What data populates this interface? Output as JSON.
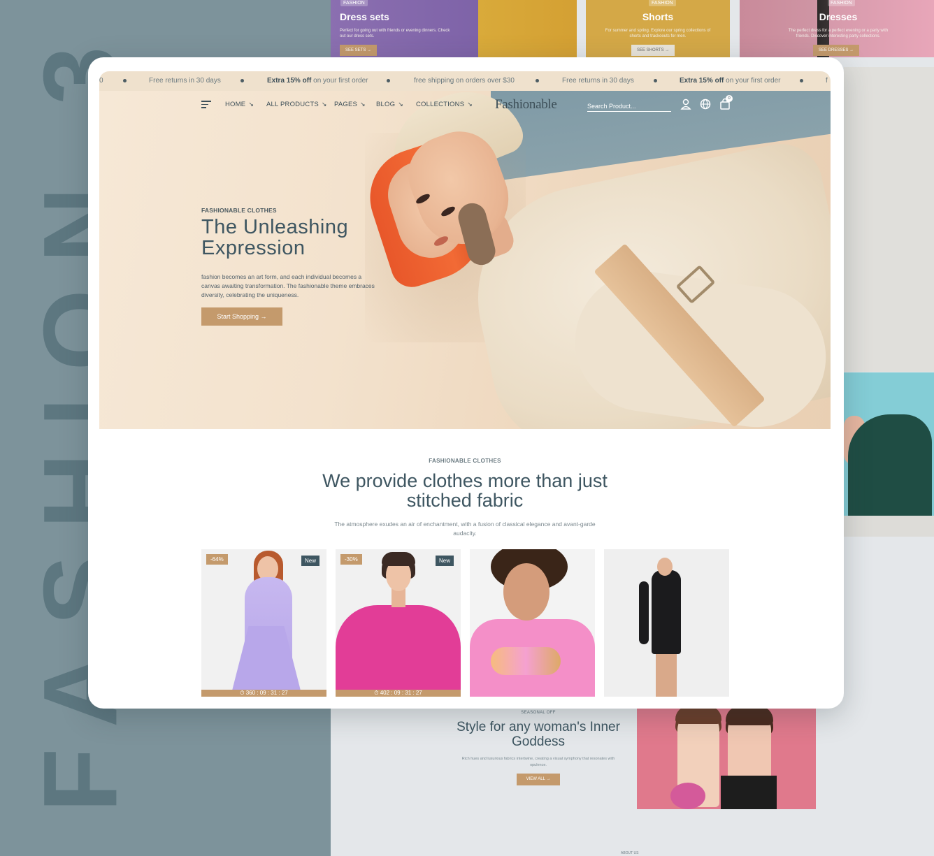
{
  "background": {
    "vertical_word": "FASHION 3",
    "colors": {
      "left_panel": "#7d939b",
      "right_panel": "#e4e7ea",
      "accent": "#c49a6c",
      "heading": "#3e5661"
    },
    "top_cards": [
      {
        "badge": "FASHION",
        "title": "Dress sets",
        "desc": "Perfect for going out with friends or evening dinners. Check out our dress sets.",
        "button": "SEE SETS →"
      },
      {
        "badge": "FASHION",
        "title": "Shorts",
        "desc": "For summer and spring. Explore our spring collections of shorts and trackoouts for men.",
        "button": "SEE SHORTS →"
      },
      {
        "badge": "FASHION",
        "title": "Dresses",
        "desc": "The perfect dress for a perfect evening or a party with friends. Discover interesting party collections.",
        "button": "SEE DRESSES →"
      }
    ],
    "seasonal": {
      "kicker": "SEASONAL OFF",
      "title": "Style for any woman's Inner Goddess",
      "desc": "Rich hues and luxurious fabrics intertwine, creating a visual symphony that resonates with opulence.",
      "button": "VIEW ALL →"
    },
    "about_label": "ABOUT US"
  },
  "ticker": {
    "items": [
      {
        "text": "0",
        "bold": ""
      },
      {
        "text": "Free returns in 30 days",
        "bold": ""
      },
      {
        "bold": "Extra 15% off",
        "text": " on your first order"
      },
      {
        "text": "free shipping on orders over $30",
        "bold": ""
      },
      {
        "text": "Free returns in 30 days",
        "bold": ""
      },
      {
        "bold": "Extra 15% off",
        "text": " on your first order"
      },
      {
        "text": "f",
        "bold": ""
      }
    ]
  },
  "nav": {
    "items": [
      "HOME",
      "ALL PRODUCTS",
      "PAGES",
      "BLOG",
      "COLLECTIONS"
    ],
    "arrow": "↘",
    "logo": "Fashionable",
    "search_placeholder": "Search Product...",
    "cart_count": "0",
    "icons": [
      "menu-icon",
      "user-icon",
      "globe-icon",
      "cart-icon"
    ]
  },
  "hero": {
    "kicker": "FASHIONABLE CLOTHES",
    "title": "The Unleashing Expression",
    "desc": "fashion becomes an art form, and each individual becomes a canvas awaiting transformation. The fashionable theme embraces diversity, celebrating the uniqueness.",
    "button": "Start Shopping →"
  },
  "section": {
    "kicker": "FASHIONABLE CLOTHES",
    "title": "We provide clothes more than just stitched fabric",
    "desc": "The atmosphere exudes an air of enchantment, with a fusion of classical elegance and avant-garde audacity."
  },
  "products": [
    {
      "discount": "-64%",
      "tag": "New",
      "timer": "⏱ 360 : 09 : 31 : 27"
    },
    {
      "discount": "-30%",
      "tag": "New",
      "timer": "⏱ 402 : 09 : 31 : 27"
    },
    {
      "discount": "",
      "tag": "",
      "timer": ""
    },
    {
      "discount": "",
      "tag": "",
      "timer": ""
    }
  ]
}
